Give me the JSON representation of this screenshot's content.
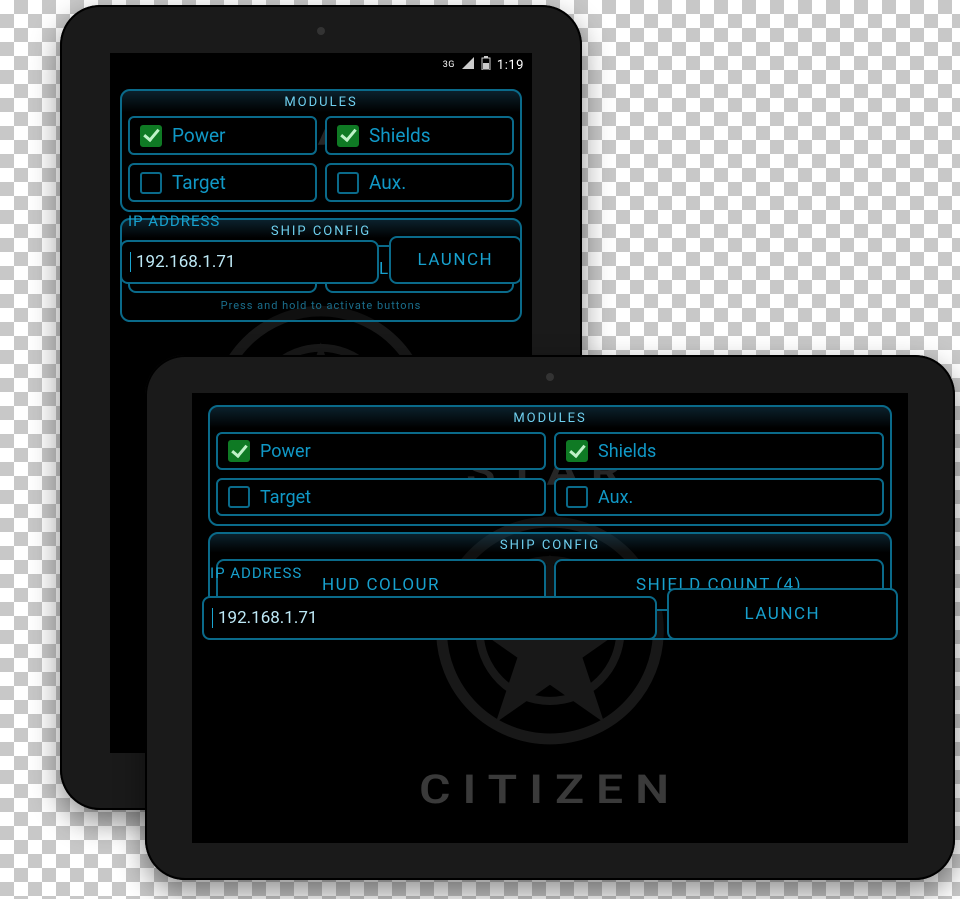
{
  "status": {
    "net": "3G",
    "time": "1:19"
  },
  "modules": {
    "title": "MODULES",
    "items": [
      {
        "label": "Power",
        "checked": true
      },
      {
        "label": "Shields",
        "checked": true
      },
      {
        "label": "Target",
        "checked": false
      },
      {
        "label": "Aux.",
        "checked": false
      }
    ]
  },
  "shipconfig": {
    "title": "SHIP CONFIG",
    "hud": "HUD COLOUR",
    "shield": "SHIELD COUNT (4)",
    "hint": "Press and hold to activate buttons"
  },
  "ip": {
    "label": "IP ADDRESS",
    "value": "192.168.1.71"
  },
  "launch": "LAUNCH",
  "watermark": {
    "top": "STAR",
    "bottom": "CITIZEN"
  }
}
